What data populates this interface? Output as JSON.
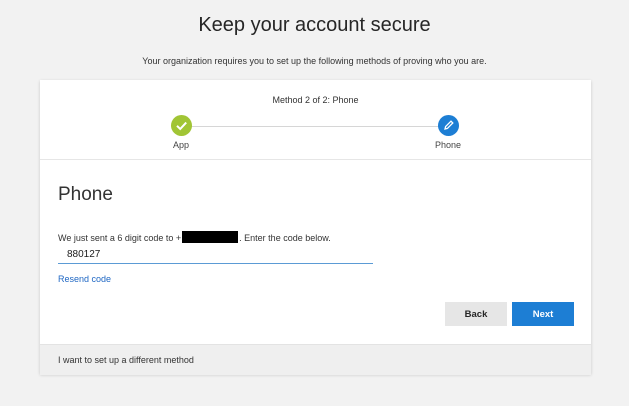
{
  "header": {
    "title": "Keep your account secure",
    "subtitle": "Your organization requires you to set up the following methods of proving who you are."
  },
  "progress": {
    "step_label": "Method 2 of 2: Phone",
    "steps": [
      {
        "label": "App",
        "status": "complete",
        "icon": "check-icon",
        "color": "#a1c535"
      },
      {
        "label": "Phone",
        "status": "current",
        "icon": "pencil-icon",
        "color": "#1d7ed4"
      }
    ]
  },
  "phone": {
    "title": "Phone",
    "instruction_prefix": "We just sent a 6 digit code to +",
    "instruction_suffix": ". Enter the code below.",
    "code_value": "880127",
    "resend_label": "Resend code"
  },
  "buttons": {
    "back_label": "Back",
    "next_label": "Next"
  },
  "footer": {
    "alternate_method_label": "I want to set up a different method"
  },
  "colors": {
    "accent": "#1d7ed4",
    "success": "#a1c535",
    "link": "#2068c4"
  }
}
